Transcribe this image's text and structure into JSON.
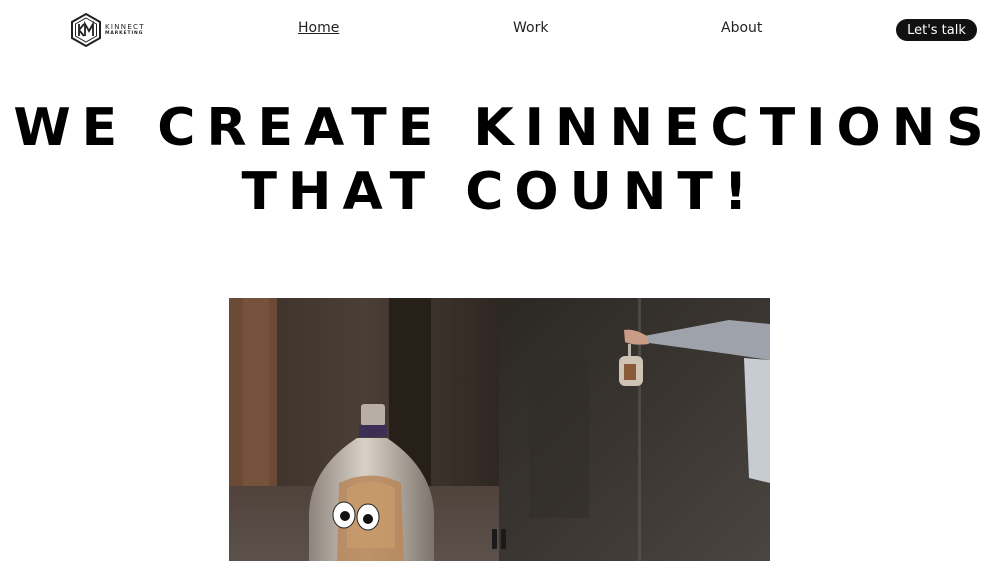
{
  "header": {
    "logo": {
      "line1": "KINNECT",
      "line2": "MARKETING",
      "icon": "km-hexagon-logo-icon"
    },
    "nav": [
      {
        "label": "Home",
        "active": true
      },
      {
        "label": "Work",
        "active": false
      },
      {
        "label": "About",
        "active": false
      }
    ],
    "cta_label": "Let's talk"
  },
  "hero": {
    "headline_line1": "WE CREATE KINNECTIONS",
    "headline_line2": "THAT COUNT!"
  },
  "video": {
    "state": "playing",
    "control_icon": "pause-icon"
  },
  "colors": {
    "background": "#ffffff",
    "text": "#111111",
    "cta_background": "#111111",
    "cta_text": "#ffffff"
  }
}
